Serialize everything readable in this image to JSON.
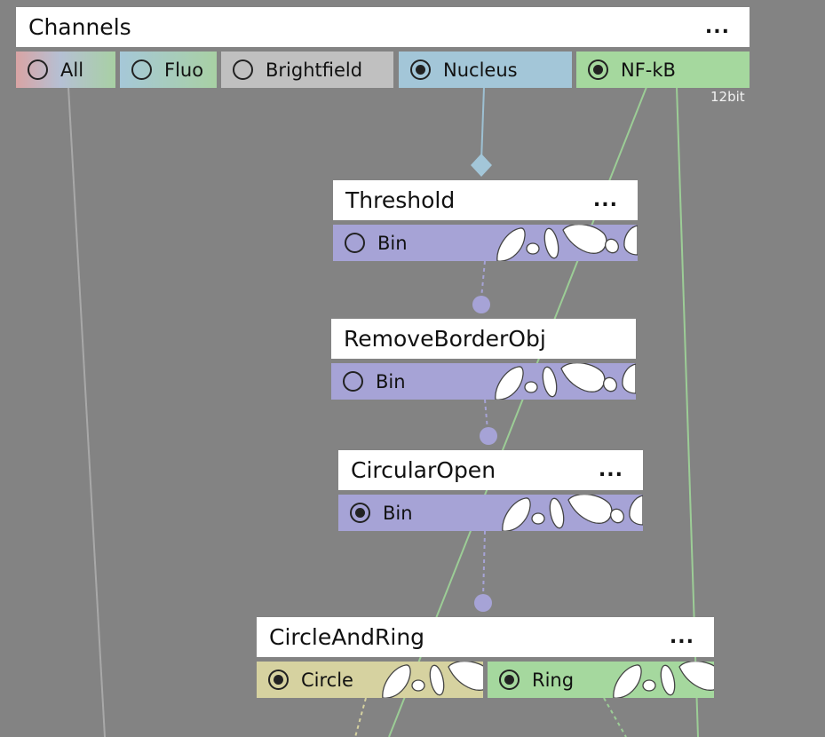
{
  "colors": {
    "background": "#838383",
    "bin": "#a6a3d6",
    "fluo": "#a8d0a4",
    "brightfield": "#c0c0c0",
    "nucleus": "#a3c6d8",
    "nfkb": "#a5d89e",
    "circle": "#d6d2a0",
    "ring": "#a5d89e"
  },
  "channels": {
    "title": "Channels",
    "menu": "...",
    "bitdepth": "12bit",
    "tabs": [
      {
        "label": "All",
        "selected": false
      },
      {
        "label": "Fluo",
        "selected": false
      },
      {
        "label": "Brightfield",
        "selected": false
      },
      {
        "label": "Nucleus",
        "selected": true
      },
      {
        "label": "NF-kB",
        "selected": true
      }
    ]
  },
  "nodes": {
    "threshold": {
      "title": "Threshold",
      "menu": "...",
      "port": {
        "label": "Bin",
        "selected": false
      }
    },
    "removeborder": {
      "title": "RemoveBorderObj",
      "port": {
        "label": "Bin",
        "selected": false
      }
    },
    "circularopen": {
      "title": "CircularOpen",
      "menu": "...",
      "port": {
        "label": "Bin",
        "selected": true
      }
    },
    "circlering": {
      "title": "CircleAndRing",
      "menu": "...",
      "ports": [
        {
          "label": "Circle",
          "selected": true
        },
        {
          "label": "Ring",
          "selected": true
        }
      ]
    }
  }
}
